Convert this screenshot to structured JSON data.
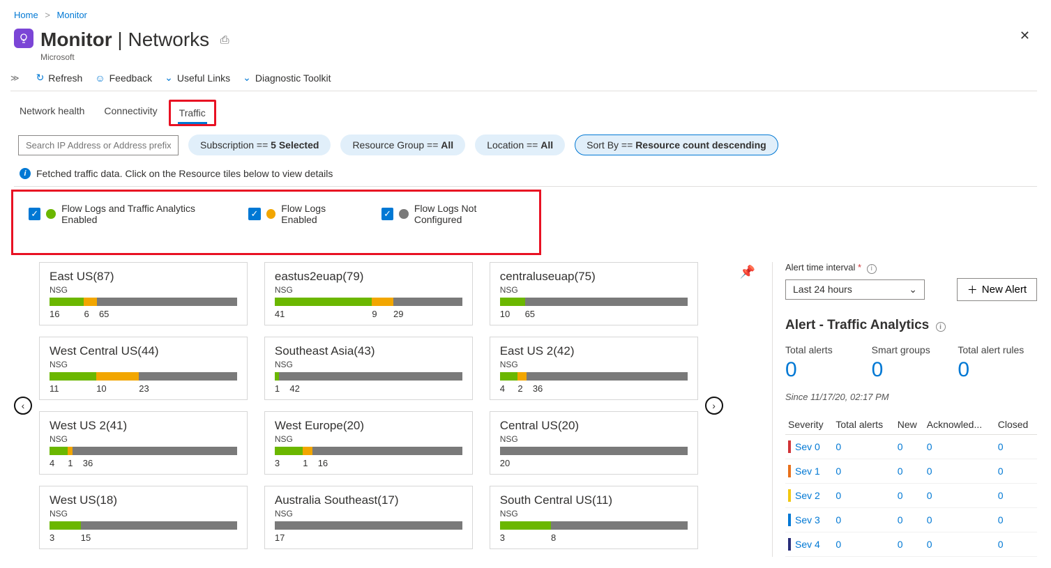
{
  "breadcrumbs": {
    "home": "Home",
    "monitor": "Monitor"
  },
  "header": {
    "title_bold": "Monitor",
    "title_rest": "Networks",
    "subtitle": "Microsoft"
  },
  "toolbar": {
    "refresh": "Refresh",
    "feedback": "Feedback",
    "useful_links": "Useful Links",
    "diagnostic": "Diagnostic Toolkit"
  },
  "tabs": {
    "network_health": "Network health",
    "connectivity": "Connectivity",
    "traffic": "Traffic"
  },
  "search_placeholder": "Search IP Address or Address prefix",
  "filters": {
    "subscription_prefix": "Subscription == ",
    "subscription_value": "5 Selected",
    "rg_prefix": "Resource Group == ",
    "rg_value": "All",
    "location_prefix": "Location == ",
    "location_value": "All",
    "sort_prefix": "Sort By == ",
    "sort_value": "Resource count descending"
  },
  "info_message": "Fetched traffic data. Click on the Resource tiles below to view details",
  "legend": {
    "enabled_both": "Flow Logs and Traffic Analytics Enabled",
    "enabled_flow": "Flow Logs Enabled",
    "not_configured": "Flow Logs Not Configured"
  },
  "tiles": [
    {
      "title": "East US(87)",
      "sub": "NSG",
      "green": 16,
      "orange": 6,
      "gray": 65
    },
    {
      "title": "eastus2euap(79)",
      "sub": "NSG",
      "green": 41,
      "orange": 9,
      "gray": 29
    },
    {
      "title": "centraluseuap(75)",
      "sub": "NSG",
      "green": 10,
      "orange": 0,
      "gray": 65
    },
    {
      "title": "West Central US(44)",
      "sub": "NSG",
      "green": 11,
      "orange": 10,
      "gray": 23
    },
    {
      "title": "Southeast Asia(43)",
      "sub": "NSG",
      "green": 1,
      "orange": 0,
      "gray": 42
    },
    {
      "title": "East US 2(42)",
      "sub": "NSG",
      "green": 4,
      "orange": 2,
      "gray": 36
    },
    {
      "title": "West US 2(41)",
      "sub": "NSG",
      "green": 4,
      "orange": 1,
      "gray": 36
    },
    {
      "title": "West Europe(20)",
      "sub": "NSG",
      "green": 3,
      "orange": 1,
      "gray": 16
    },
    {
      "title": "Central US(20)",
      "sub": "NSG",
      "green": 0,
      "orange": 0,
      "gray": 20
    },
    {
      "title": "West US(18)",
      "sub": "NSG",
      "green": 3,
      "orange": 0,
      "gray": 15
    },
    {
      "title": "Australia Southeast(17)",
      "sub": "NSG",
      "green": 0,
      "orange": 0,
      "gray": 17
    },
    {
      "title": "South Central US(11)",
      "sub": "NSG",
      "green": 3,
      "orange": 0,
      "gray": 8
    }
  ],
  "right": {
    "interval_label": "Alert time interval",
    "interval_value": "Last 24 hours",
    "new_alert": "New Alert",
    "panel_title": "Alert - Traffic Analytics",
    "metrics": {
      "total_alerts_label": "Total alerts",
      "total_alerts_value": "0",
      "smart_groups_label": "Smart groups",
      "smart_groups_value": "0",
      "total_rules_label": "Total alert rules",
      "total_rules_value": "0"
    },
    "since": "Since 11/17/20, 02:17 PM",
    "table": {
      "headers": {
        "severity": "Severity",
        "total": "Total alerts",
        "new": "New",
        "ack": "Acknowled...",
        "closed": "Closed"
      },
      "rows": [
        {
          "sev": "Sev 0",
          "cls": "sev0",
          "total": "0",
          "new": "0",
          "ack": "0",
          "closed": "0"
        },
        {
          "sev": "Sev 1",
          "cls": "sev1",
          "total": "0",
          "new": "0",
          "ack": "0",
          "closed": "0"
        },
        {
          "sev": "Sev 2",
          "cls": "sev2",
          "total": "0",
          "new": "0",
          "ack": "0",
          "closed": "0"
        },
        {
          "sev": "Sev 3",
          "cls": "sev3",
          "total": "0",
          "new": "0",
          "ack": "0",
          "closed": "0"
        },
        {
          "sev": "Sev 4",
          "cls": "sev4",
          "total": "0",
          "new": "0",
          "ack": "0",
          "closed": "0"
        }
      ]
    }
  },
  "chart_data": {
    "type": "bar",
    "note": "Stacked per-region NSG counts: green = Flow Logs + Traffic Analytics enabled, orange = Flow Logs enabled, gray = not configured",
    "categories": [
      "East US",
      "eastus2euap",
      "centraluseuap",
      "West Central US",
      "Southeast Asia",
      "East US 2",
      "West US 2",
      "West Europe",
      "Central US",
      "West US",
      "Australia Southeast",
      "South Central US"
    ],
    "series": [
      {
        "name": "Flow Logs and Traffic Analytics Enabled",
        "color": "#6bb700",
        "values": [
          16,
          41,
          10,
          11,
          1,
          4,
          4,
          3,
          0,
          3,
          0,
          3
        ]
      },
      {
        "name": "Flow Logs Enabled",
        "color": "#f2a600",
        "values": [
          6,
          9,
          0,
          10,
          0,
          2,
          1,
          1,
          0,
          0,
          0,
          0
        ]
      },
      {
        "name": "Flow Logs Not Configured",
        "color": "#7a7a7a",
        "values": [
          65,
          29,
          65,
          23,
          42,
          36,
          36,
          16,
          20,
          15,
          17,
          8
        ]
      }
    ]
  }
}
